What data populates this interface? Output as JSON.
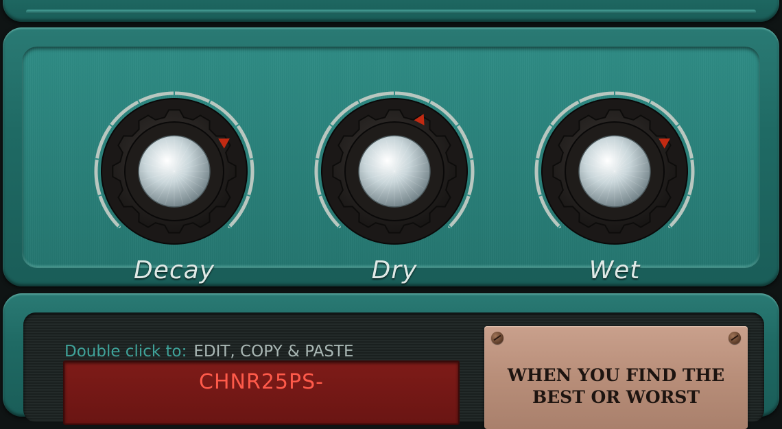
{
  "knobs": [
    {
      "id": "decay",
      "label": "Decay",
      "value": 0.72
    },
    {
      "id": "dry",
      "label": "Dry",
      "value": 0.6
    },
    {
      "id": "wet",
      "label": "Wet",
      "value": 0.72
    }
  ],
  "preset": {
    "hint_lead": "Double click to:",
    "hint_ops": "EDIT, COPY & PASTE",
    "name": "CHNR25PS-"
  },
  "plate": {
    "text": "WHEN YOU FIND THE BEST OR WORST"
  },
  "colors": {
    "panel": "#2a817a",
    "knob_indicator": "#c22a12",
    "preset_text": "#ff5a4a",
    "hint_lead": "#3fa39a",
    "plate": "#b88e79"
  }
}
